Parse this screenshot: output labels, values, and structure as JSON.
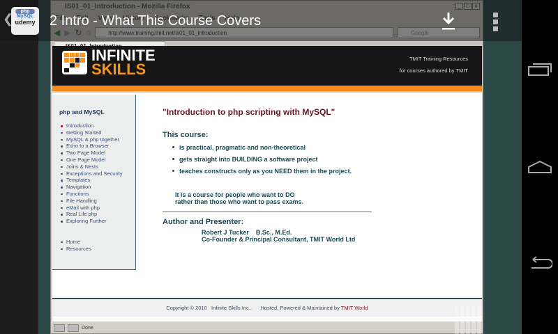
{
  "app_bar": {
    "title": "2  Intro - What This Course Covers",
    "app_icon_text": [
      "php",
      "MySQL",
      "udemy"
    ]
  },
  "browser": {
    "window_title": "IS01_01_Introduction - Mozilla Firefox",
    "menu": [
      "File",
      "Edit",
      "View",
      "History",
      "Bookmarks",
      "Tools",
      "Help"
    ],
    "url": "http://www.training.tmit.net/is01_01_introduction",
    "search_placeholder": "Google",
    "tab": "IS01_01_Introduction",
    "status": "Done"
  },
  "site": {
    "logo": [
      "INFINITE",
      "SKILLS"
    ],
    "header_right": [
      "TMIT Training Resources",
      "for courses authored by TMIT"
    ],
    "sidebar": {
      "title": "php and MySQL",
      "items": [
        "Introduction",
        "Getting Started",
        "MySQL & php together",
        "Echo to a Browser",
        "Two Page Model",
        "One Page Model",
        "Joins & Nests",
        "Exceptions and Security",
        "Templates",
        "Navigation",
        "Functions",
        "File Handling",
        "eMail with php",
        "Real Life php",
        "Exploring Further"
      ],
      "links": [
        "Home",
        "Resources"
      ]
    },
    "main": {
      "title": "\"Introduction to php scripting with MySQL\"",
      "course_heading": "This course:",
      "bullets": [
        "is practical, pragmatic and non-theoretical",
        "gets straight into BUILDING a software project",
        "teaches constructs only as you NEED them in the project."
      ],
      "para": [
        "It is a course for people who want to DO",
        "rather than those who want to pass exams."
      ],
      "author_heading": "Author and Presenter:",
      "author": [
        "Robert J Tucker    B.Sc., M.Ed.",
        "Co-Founder & Principal Consultant, TMIT World Ltd"
      ]
    },
    "footer": {
      "copyright": "Copyright © 2010   Infinite Skills Inc..      Hosted, Powered & Maintained by ",
      "tmit": "TMIT World"
    }
  }
}
